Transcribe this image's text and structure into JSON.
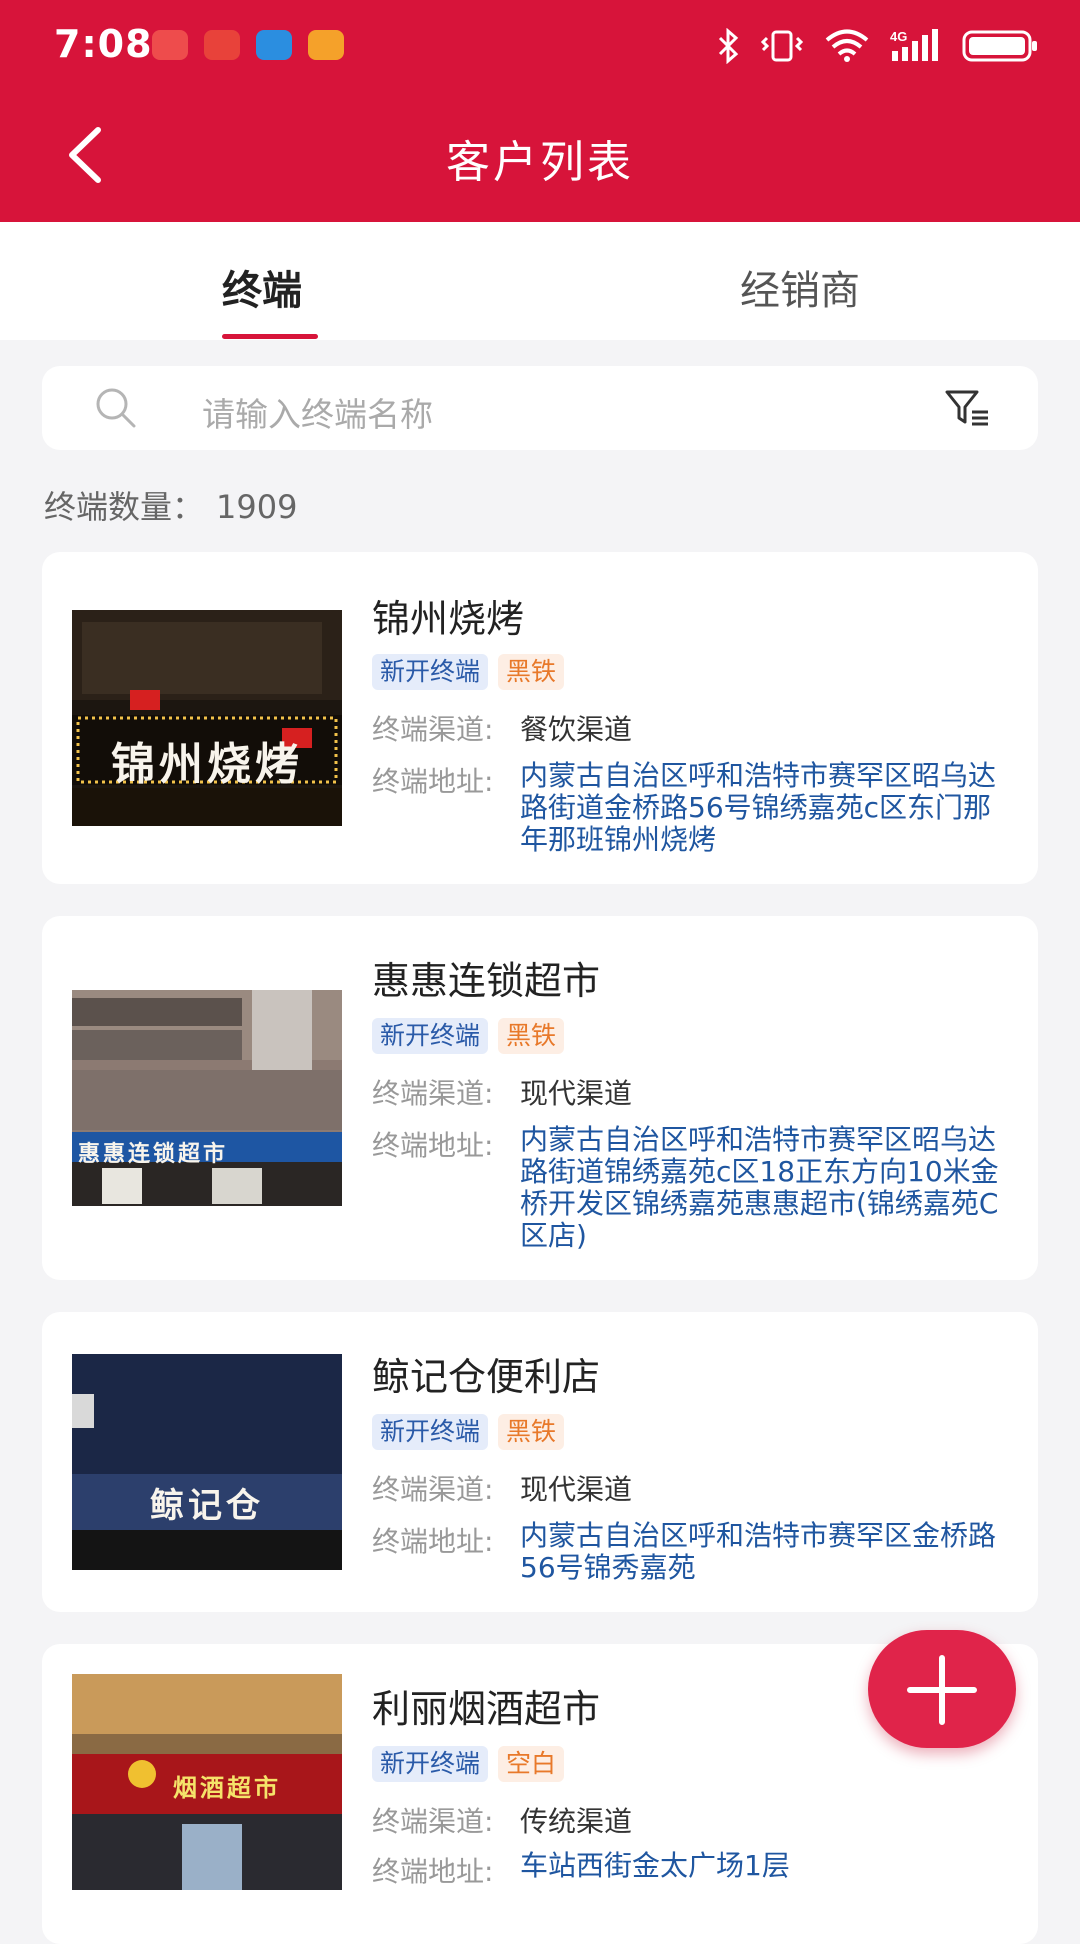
{
  "status_bar": {
    "time": "7:08",
    "notification_icons": [
      "huawei-app-icon",
      "book-app-icon",
      "browser-app-icon",
      "video-app-icon"
    ],
    "system_icons": [
      "bluetooth-icon",
      "vibrate-icon",
      "wifi-icon",
      "4g-signal-icon",
      "battery-icon"
    ]
  },
  "header": {
    "title": "客户列表"
  },
  "tabs": [
    {
      "label": "终端",
      "selected": true
    },
    {
      "label": "经销商",
      "selected": false
    }
  ],
  "search": {
    "placeholder": "请输入终端名称"
  },
  "summary": {
    "count_label": "终端数量：",
    "count_value": "1909"
  },
  "customers": [
    {
      "name": "锦州烧烤",
      "tags": [
        "新开终端",
        "黑铁"
      ],
      "channel_label": "终端渠道:",
      "channel": "餐饮渠道",
      "address_label": "终端地址:",
      "address": "内蒙古自治区呼和浩特市赛罕区昭乌达路街道金桥路56号锦绣嘉苑c区东门那年那班锦州烧烤",
      "photo_sign": "锦州烧烤"
    },
    {
      "name": "惠惠连锁超市",
      "tags": [
        "新开终端",
        "黑铁"
      ],
      "channel_label": "终端渠道:",
      "channel": "现代渠道",
      "address_label": "终端地址:",
      "address": "内蒙古自治区呼和浩特市赛罕区昭乌达路街道锦绣嘉苑c区18正东方向10米金桥开发区锦绣嘉苑惠惠超市(锦绣嘉苑C区店)",
      "photo_sign": "惠惠连锁超市"
    },
    {
      "name": "鲸记仓便利店",
      "tags": [
        "新开终端",
        "黑铁"
      ],
      "channel_label": "终端渠道:",
      "channel": "现代渠道",
      "address_label": "终端地址:",
      "address": "内蒙古自治区呼和浩特市赛罕区金桥路56号锦秀嘉苑",
      "photo_sign": "鲸记仓"
    },
    {
      "name": "利丽烟酒超市",
      "tags": [
        "新开终端",
        "空白"
      ],
      "channel_label": "终端渠道:",
      "channel": "传统渠道",
      "address_label": "终端地址:",
      "address": "车站西街金太广场1层",
      "photo_sign": "烟酒超市"
    }
  ],
  "fab": {
    "icon": "plus-icon"
  },
  "colors": {
    "brand_red": "#d7143a",
    "tag_blue_text": "#2a5aa8",
    "tag_orange_text": "#e8792a",
    "address_blue": "#1f56a0"
  }
}
